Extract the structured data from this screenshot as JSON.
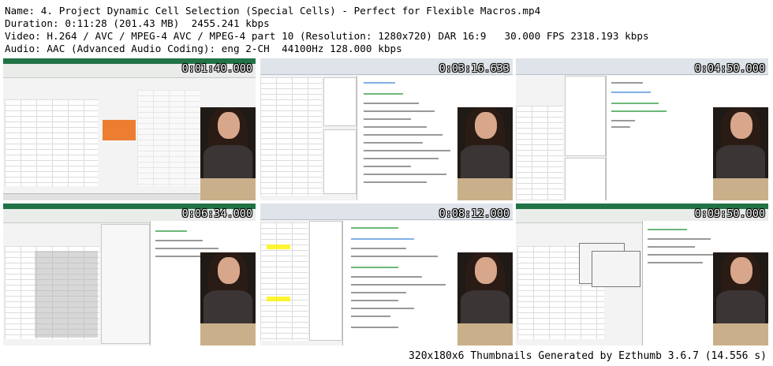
{
  "header": {
    "line1": "Name: 4. Project Dynamic Cell Selection (Special Cells) - Perfect for Flexible Macros.mp4",
    "line2": "Duration: 0:11:28 (201.43 MB)  2455.241 kbps",
    "line3": "Video: H.264 / AVC / MPEG-4 AVC / MPEG-4 part 10 (Resolution: 1280x720) DAR 16:9   30.000 FPS 2318.193 kbps",
    "line4": "Audio: AAC (Advanced Audio Coding): eng 2-CH  44100Hz 128.000 kbps"
  },
  "thumbnails": [
    {
      "timestamp": "0:01:40.000",
      "scene": "excel-sheet"
    },
    {
      "timestamp": "0:03:16.633",
      "scene": "vba-editor-code"
    },
    {
      "timestamp": "0:04:50.000",
      "scene": "vba-editor-sheet"
    },
    {
      "timestamp": "0:06:34.000",
      "scene": "excel-menu"
    },
    {
      "timestamp": "0:08:12.000",
      "scene": "vba-editor-code"
    },
    {
      "timestamp": "0:09:50.000",
      "scene": "excel-dialog"
    }
  ],
  "footer": "320x180x6 Thumbnails Generated by Ezthumb 3.6.7 (14.556 s)"
}
